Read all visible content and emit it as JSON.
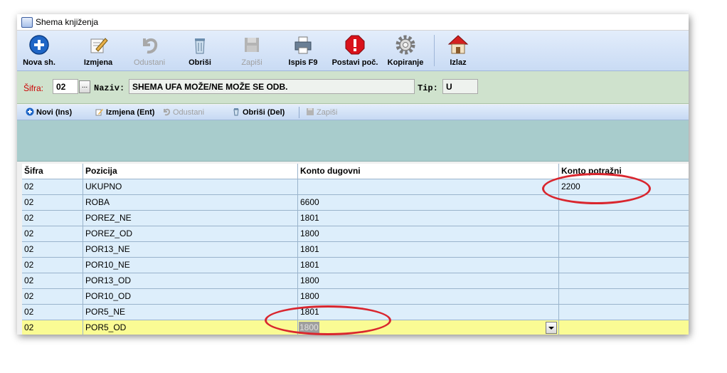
{
  "window": {
    "title": "Shema knjiženja"
  },
  "toolbar": {
    "buttons": [
      {
        "label": "Nova sh.",
        "enabled": true,
        "icon": "plus-circle-icon"
      },
      {
        "label": "Izmjena",
        "enabled": true,
        "icon": "pencil-paper-icon"
      },
      {
        "label": "Odustani",
        "enabled": false,
        "icon": "undo-arrow-icon"
      },
      {
        "label": "Obriši",
        "enabled": true,
        "icon": "trash-bin-icon"
      },
      {
        "label": "Zapiši",
        "enabled": false,
        "icon": "save-disk-icon"
      },
      {
        "label": "Ispis F9",
        "enabled": true,
        "icon": "printer-icon"
      },
      {
        "label": "Postavi poč.",
        "enabled": true,
        "icon": "stop-sign-icon"
      },
      {
        "label": "Kopiranje",
        "enabled": true,
        "icon": "gear-icon"
      },
      {
        "label": "Izlaz",
        "enabled": true,
        "icon": "home-icon"
      }
    ]
  },
  "header": {
    "sifra_label": "Šifra:",
    "sifra_value": "02",
    "lookup_button": "...",
    "naziv_label": "Naziv:",
    "naziv_value": "SHEMA UFA MOŽE/NE MOŽE SE ODB.",
    "tip_label": "Tip:",
    "tip_value": "U",
    "accent_color": "#cc0000"
  },
  "detail_toolbar": {
    "buttons": [
      {
        "label": "Novi (Ins)",
        "enabled": true
      },
      {
        "label": "Izmjena (Ent)",
        "enabled": true
      },
      {
        "label": "Odustani",
        "enabled": false
      },
      {
        "label": "Obriši (Del)",
        "enabled": true
      },
      {
        "label": "Zapiši",
        "enabled": false
      }
    ]
  },
  "grid": {
    "columns": [
      "Šifra",
      "Pozicija",
      "Konto dugovni",
      "Konto potražni"
    ],
    "rows": [
      [
        "02",
        "UKUPNO",
        "",
        "2200"
      ],
      [
        "02",
        "ROBA",
        "6600",
        ""
      ],
      [
        "02",
        "POREZ_NE",
        "1801",
        ""
      ],
      [
        "02",
        "POREZ_OD",
        "1800",
        ""
      ],
      [
        "02",
        "POR13_NE",
        "1801",
        ""
      ],
      [
        "02",
        "POR10_NE",
        "1801",
        ""
      ],
      [
        "02",
        "POR13_OD",
        "1800",
        ""
      ],
      [
        "02",
        "POR10_OD",
        "1800",
        ""
      ],
      [
        "02",
        "POR5_NE",
        "1801",
        ""
      ],
      [
        "02",
        "POR5_OD",
        "1800",
        ""
      ]
    ],
    "selected_row": 9,
    "row_color": "#ddeefb",
    "selected_color": "#fafb94"
  },
  "annotation_color": "#d9262e"
}
